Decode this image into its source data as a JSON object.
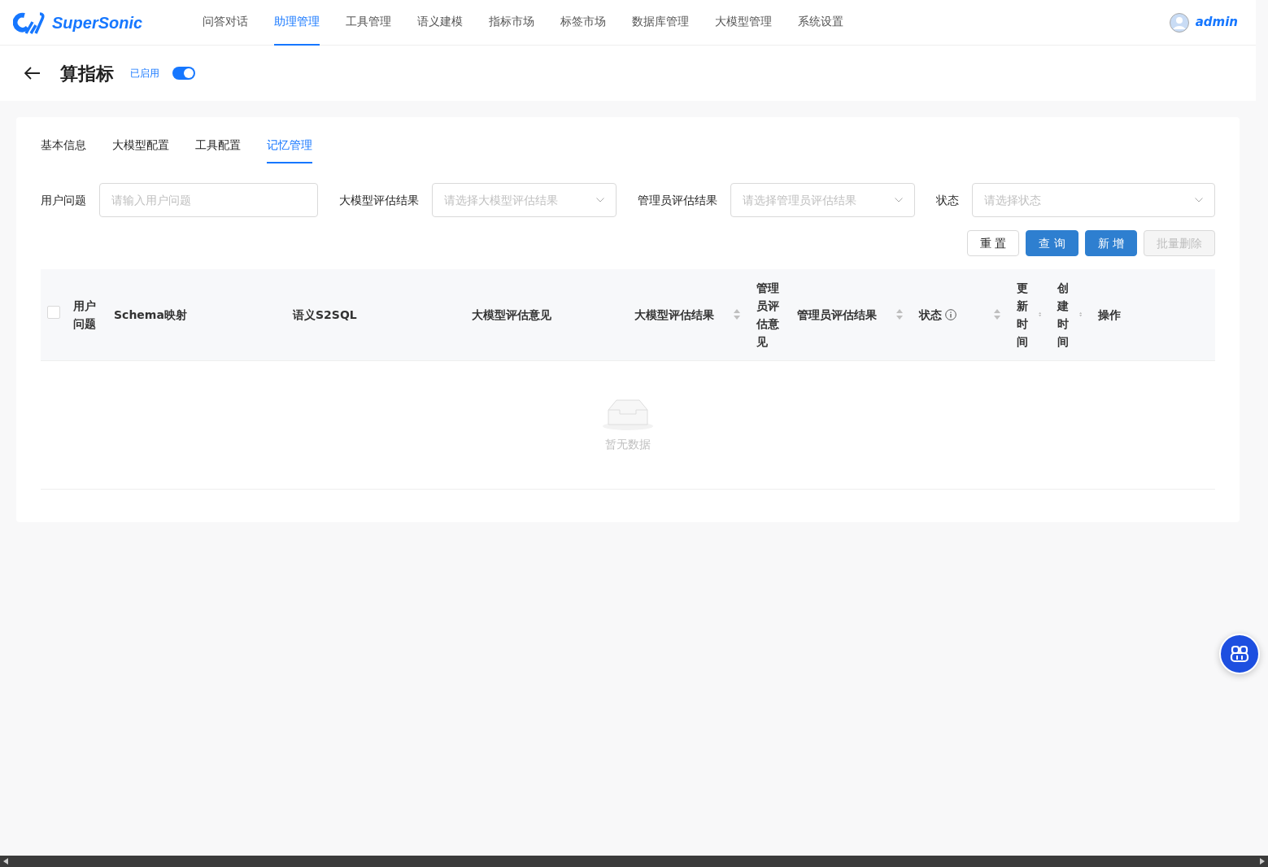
{
  "brand": "SuperSonic",
  "nav": [
    {
      "label": "问答对话",
      "selected": false
    },
    {
      "label": "助理管理",
      "selected": true
    },
    {
      "label": "工具管理",
      "selected": false
    },
    {
      "label": "语义建模",
      "selected": false
    },
    {
      "label": "指标市场",
      "selected": false
    },
    {
      "label": "标签市场",
      "selected": false
    },
    {
      "label": "数据库管理",
      "selected": false
    },
    {
      "label": "大模型管理",
      "selected": false
    },
    {
      "label": "系统设置",
      "selected": false
    }
  ],
  "user": "admin",
  "page": {
    "title": "算指标",
    "status_label": "已启用",
    "enabled": true
  },
  "tabs": [
    {
      "label": "基本信息",
      "selected": false
    },
    {
      "label": "大模型配置",
      "selected": false
    },
    {
      "label": "工具配置",
      "selected": false
    },
    {
      "label": "记忆管理",
      "selected": true
    }
  ],
  "filters": [
    {
      "label": "用户问题",
      "kind": "input",
      "placeholder": "请输入用户问题"
    },
    {
      "label": "大模型评估结果",
      "kind": "select",
      "placeholder": "请选择大模型评估结果"
    },
    {
      "label": "管理员评估结果",
      "kind": "select",
      "placeholder": "请选择管理员评估结果"
    },
    {
      "label": "状态",
      "kind": "select",
      "placeholder": "请选择状态"
    }
  ],
  "buttons": [
    {
      "label": "重 置",
      "kind": "default",
      "disabled": false
    },
    {
      "label": "查 询",
      "kind": "primary",
      "disabled": false
    },
    {
      "label": "新 增",
      "kind": "primary",
      "disabled": false
    },
    {
      "label": "批量删除",
      "kind": "default",
      "disabled": true
    }
  ],
  "table": {
    "select_all_checked": false,
    "columns": [
      {
        "label": "用户问题",
        "sortable": false,
        "info": false
      },
      {
        "label": "Schema映射",
        "sortable": false,
        "info": false
      },
      {
        "label": "语义S2SQL",
        "sortable": false,
        "info": false
      },
      {
        "label": "大模型评估意见",
        "sortable": false,
        "info": false
      },
      {
        "label": "大模型评估结果",
        "sortable": true,
        "info": false
      },
      {
        "label": "管理员评估意见",
        "sortable": false,
        "info": false
      },
      {
        "label": "管理员评估结果",
        "sortable": true,
        "info": false
      },
      {
        "label": "状态",
        "sortable": true,
        "info": true
      },
      {
        "label": "更新时间",
        "sortable": true,
        "info": false
      },
      {
        "label": "创建时间",
        "sortable": true,
        "info": false
      },
      {
        "label": "操作",
        "sortable": false,
        "info": false
      }
    ],
    "empty_text": "暂无数据"
  }
}
